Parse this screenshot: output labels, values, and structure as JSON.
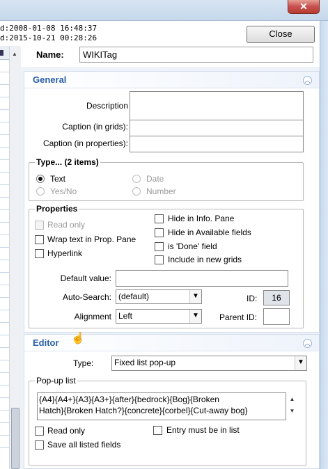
{
  "window": {
    "close_glyph": "✕",
    "created_line": "d:2008-01-08 16:48:37",
    "modified_line": "d:2015-10-21 00:28:26",
    "close_button": "Close",
    "close_button_accel": "C"
  },
  "name": {
    "label": "Name:",
    "value": "WIKITag"
  },
  "general": {
    "title": "General",
    "description_label": "Description",
    "caption_grids_label": "Caption (in grids):",
    "caption_props_label": "Caption (in properties):",
    "type": {
      "legend": "Type...  (2 items)",
      "options": [
        "Text",
        "Date",
        "Yes/No",
        "Number"
      ],
      "selected": "Text"
    },
    "properties": {
      "legend": "Properties",
      "read_only": "Read only",
      "wrap_text": "Wrap text in Prop. Pane",
      "hyperlink": "Hyperlink",
      "hide_info": "Hide in Info. Pane",
      "hide_available": "Hide in Available fields",
      "is_done": "is 'Done' field",
      "include_new": "Include in new grids",
      "default_value_label": "Default value:",
      "auto_search_label": "Auto-Search:",
      "auto_search_value": "(default)",
      "alignment_label": "Alignment",
      "alignment_value": "Left",
      "id_label": "ID:",
      "id_value": "16",
      "parent_id_label": "Parent ID:"
    }
  },
  "editor": {
    "title": "Editor",
    "type_label": "Type:",
    "type_value": "Fixed list pop-up",
    "popup_legend": "Pop-up list",
    "popup_line1": "{A4}{A4+}{A3}{A3+}{after}{bedrock}{Bog}{Broken",
    "popup_line2": "Hatch}{Broken Hatch?}{concrete}{corbel}{Cut-away bog}",
    "read_only": "Read only",
    "entry_must": "Entry must be in list",
    "save_all": "Save all listed fields"
  },
  "icons": {
    "collapse": "chevron-up-icon",
    "dropdown": "dropdown-arrow-icon"
  }
}
